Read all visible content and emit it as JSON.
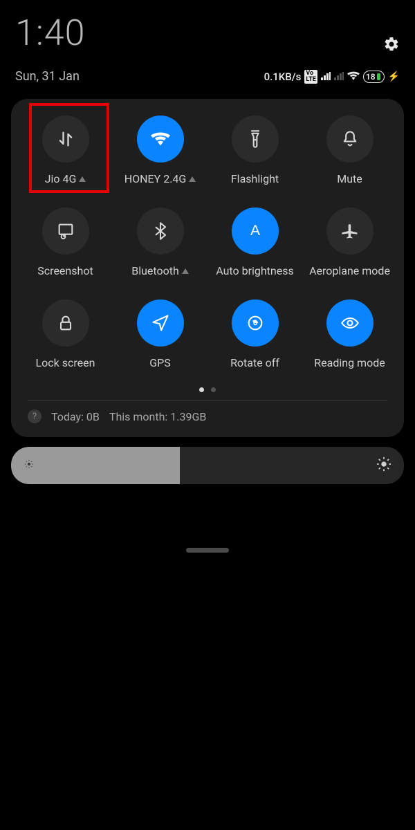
{
  "status": {
    "time": "1:40",
    "date": "Sun, 31 Jan",
    "net_speed": "0.1KB/s",
    "volte": "Vo\nLTE",
    "battery_pct": "18"
  },
  "tiles": [
    {
      "label": "Jio 4G",
      "icon": "mobile-data-icon",
      "active": false,
      "expandable": true
    },
    {
      "label": "HONEY 2.4G",
      "icon": "wifi-icon",
      "active": true,
      "expandable": true
    },
    {
      "label": "Flashlight",
      "icon": "flashlight-icon",
      "active": false,
      "expandable": false
    },
    {
      "label": "Mute",
      "icon": "bell-icon",
      "active": false,
      "expandable": false
    },
    {
      "label": "Screenshot",
      "icon": "screenshot-icon",
      "active": false,
      "expandable": false
    },
    {
      "label": "Bluetooth",
      "icon": "bluetooth-icon",
      "active": false,
      "expandable": true
    },
    {
      "label": "Auto brightness",
      "icon": "auto-brightness-icon",
      "active": true,
      "expandable": false
    },
    {
      "label": "Aeroplane mode",
      "icon": "airplane-icon",
      "active": false,
      "expandable": false
    },
    {
      "label": "Lock screen",
      "icon": "lock-icon",
      "active": false,
      "expandable": false
    },
    {
      "label": "GPS",
      "icon": "gps-icon",
      "active": true,
      "expandable": false
    },
    {
      "label": "Rotate off",
      "icon": "rotate-icon",
      "active": true,
      "expandable": false
    },
    {
      "label": "Reading mode",
      "icon": "eye-icon",
      "active": true,
      "expandable": false
    }
  ],
  "usage": {
    "today_label": "Today: 0B",
    "month_label": "This month: 1.39GB"
  },
  "brightness": {
    "percent": 43
  },
  "highlight": {
    "tile_index": 0
  }
}
